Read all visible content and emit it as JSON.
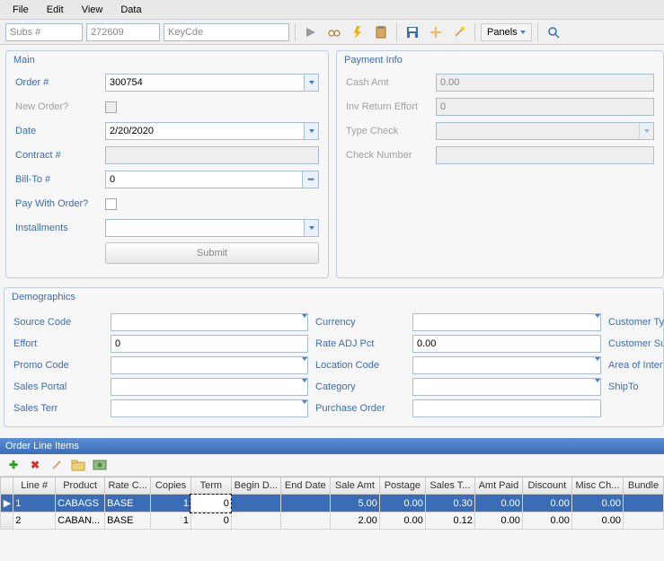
{
  "menu": {
    "file": "File",
    "edit": "Edit",
    "view": "View",
    "data": "Data"
  },
  "toolbar": {
    "subs_label": "Subs #",
    "subs_num": "272609",
    "keycde_label": "KeyCde",
    "keycde_val": "",
    "panels": "Panels"
  },
  "main": {
    "title": "Main",
    "order_label": "Order #",
    "order_val": "300754",
    "neworder_label": "New Order?",
    "date_label": "Date",
    "date_val": "2/20/2020",
    "contract_label": "Contract #",
    "contract_val": "",
    "billto_label": "Bill-To #",
    "billto_val": "0",
    "paywith_label": "Pay With Order?",
    "installments_label": "Installments",
    "installments_val": "",
    "submit": "Submit"
  },
  "pay": {
    "title": "Payment Info",
    "cashamt_label": "Cash Amt",
    "cashamt_val": "0.00",
    "invreturn_label": "Inv Return Effort",
    "invreturn_val": "0",
    "typecheck_label": "Type Check",
    "typecheck_val": "",
    "checknum_label": "Check Number",
    "checknum_val": ""
  },
  "demo": {
    "title": "Demographics",
    "source_label": "Source Code",
    "source_val": "",
    "effort_label": "Effort",
    "effort_val": "0",
    "promo_label": "Promo Code",
    "promo_val": "",
    "salesportal_label": "Sales Portal",
    "salesportal_val": "",
    "salesterr_label": "Sales Terr",
    "salesterr_val": "",
    "currency_label": "Currency",
    "currency_val": "",
    "rateadj_label": "Rate ADJ Pct",
    "rateadj_val": "0.00",
    "location_label": "Location Code",
    "location_val": "",
    "category_label": "Category",
    "category_val": "",
    "po_label": "Purchase Order",
    "po_val": "",
    "customerty_label": "Customer Ty",
    "customersu_label": "Customer Su",
    "area_label": "Area of Inter",
    "shipto_label": "ShipTo"
  },
  "lines": {
    "title": "Order Line Items",
    "cols": [
      "",
      "Line #",
      "Product",
      "Rate C...",
      "Copies",
      "Term",
      "Begin D...",
      "End Date",
      "Sale Amt",
      "Postage",
      "Sales T...",
      "Amt Paid",
      "Discount",
      "Misc Ch...",
      "Bundle"
    ],
    "rows": [
      {
        "sel": true,
        "focus_col": 5,
        "line": "1",
        "product": "CABAGS",
        "rate": "BASE",
        "copies": "1",
        "term": "0",
        "begin": "",
        "end": "",
        "sale": "5.00",
        "postage": "0.00",
        "tax": "0.30",
        "paid": "0.00",
        "disc": "0.00",
        "misc": "0.00",
        "bundle": ""
      },
      {
        "sel": false,
        "line": "2",
        "product": "CABAN...",
        "rate": "BASE",
        "copies": "1",
        "term": "0",
        "begin": "",
        "end": "",
        "sale": "2.00",
        "postage": "0.00",
        "tax": "0.12",
        "paid": "0.00",
        "disc": "0.00",
        "misc": "0.00",
        "bundle": ""
      }
    ]
  }
}
